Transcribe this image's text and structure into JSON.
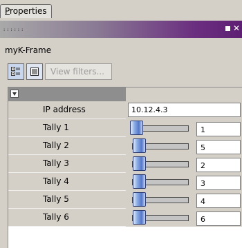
{
  "tab": {
    "label_underlined": "P",
    "label_rest": "roperties"
  },
  "titlebar": {
    "grip": "::::::"
  },
  "frame": {
    "name": "myK-Frame"
  },
  "toolbar": {
    "view_filters_label": "View filters..."
  },
  "properties": {
    "ip": {
      "label": "IP address",
      "value": "10.12.4.3"
    },
    "tallies": [
      {
        "label": "Tally 1",
        "value": "1",
        "level": 0.0
      },
      {
        "label": "Tally 2",
        "value": "5",
        "level": 0.06
      },
      {
        "label": "Tally 3",
        "value": "2",
        "level": 0.06
      },
      {
        "label": "Tally 4",
        "value": "3",
        "level": 0.06
      },
      {
        "label": "Tally 5",
        "value": "4",
        "level": 0.06
      },
      {
        "label": "Tally 6",
        "value": "6",
        "level": 0.06
      }
    ]
  }
}
